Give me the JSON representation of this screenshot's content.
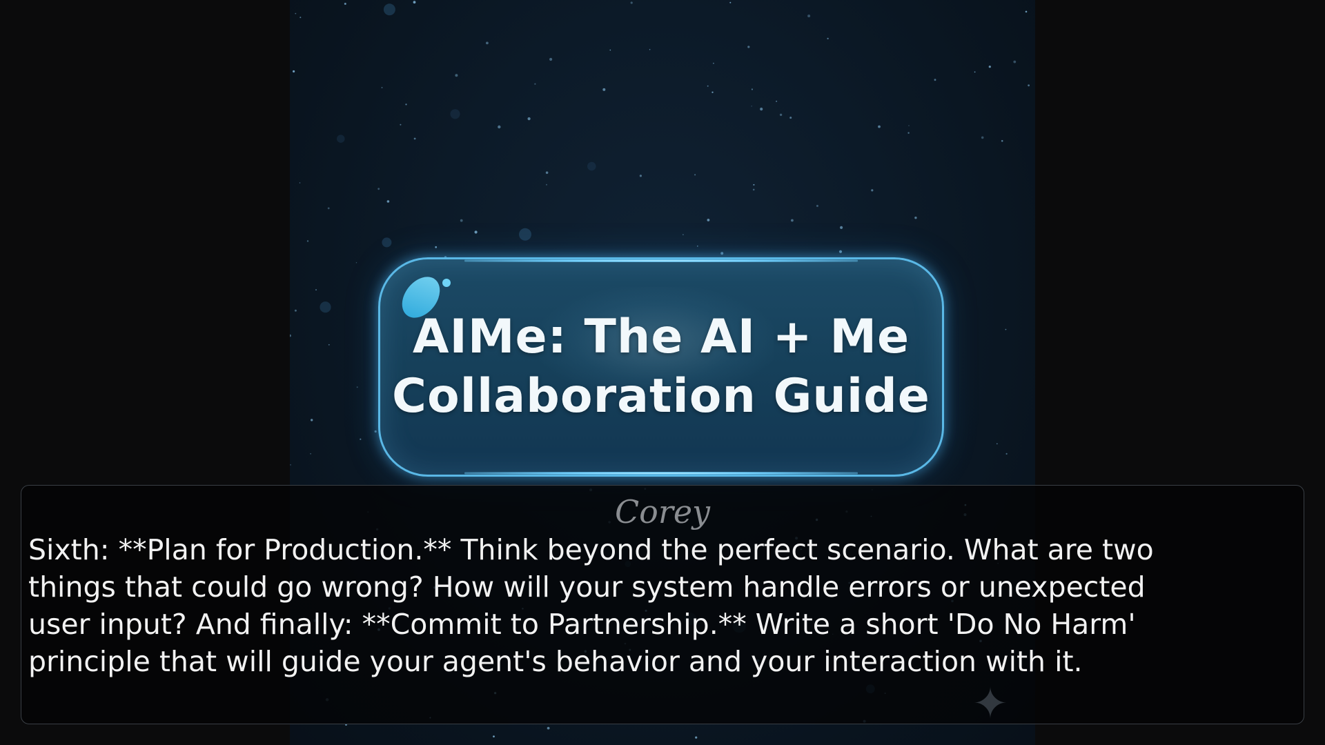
{
  "title_card": {
    "line1": "AIMe: The AI + Me",
    "line2": "Collaboration Guide"
  },
  "dialogue": {
    "speaker": "Corey",
    "text": "Sixth: **Plan for Production.** Think beyond the perfect scenario. What are two\nthings that could go wrong? How will your system handle errors or unexpected\nuser input? And finally: **Commit to Partnership.** Write a short 'Do No Harm'\nprinciple that will guide your agent's behavior and your interaction with it."
  },
  "icons": {
    "decoration": "four-point-star-icon",
    "card_highlight": "glossy-highlight-icon"
  },
  "colors": {
    "card_border": "#5ab8e6",
    "card_fill": "#16405a",
    "scene_bg": "#0c1a28",
    "dialogue_bg": "#040405",
    "speaker_color": "#8a8d91",
    "text_color": "#f2f2f2"
  }
}
